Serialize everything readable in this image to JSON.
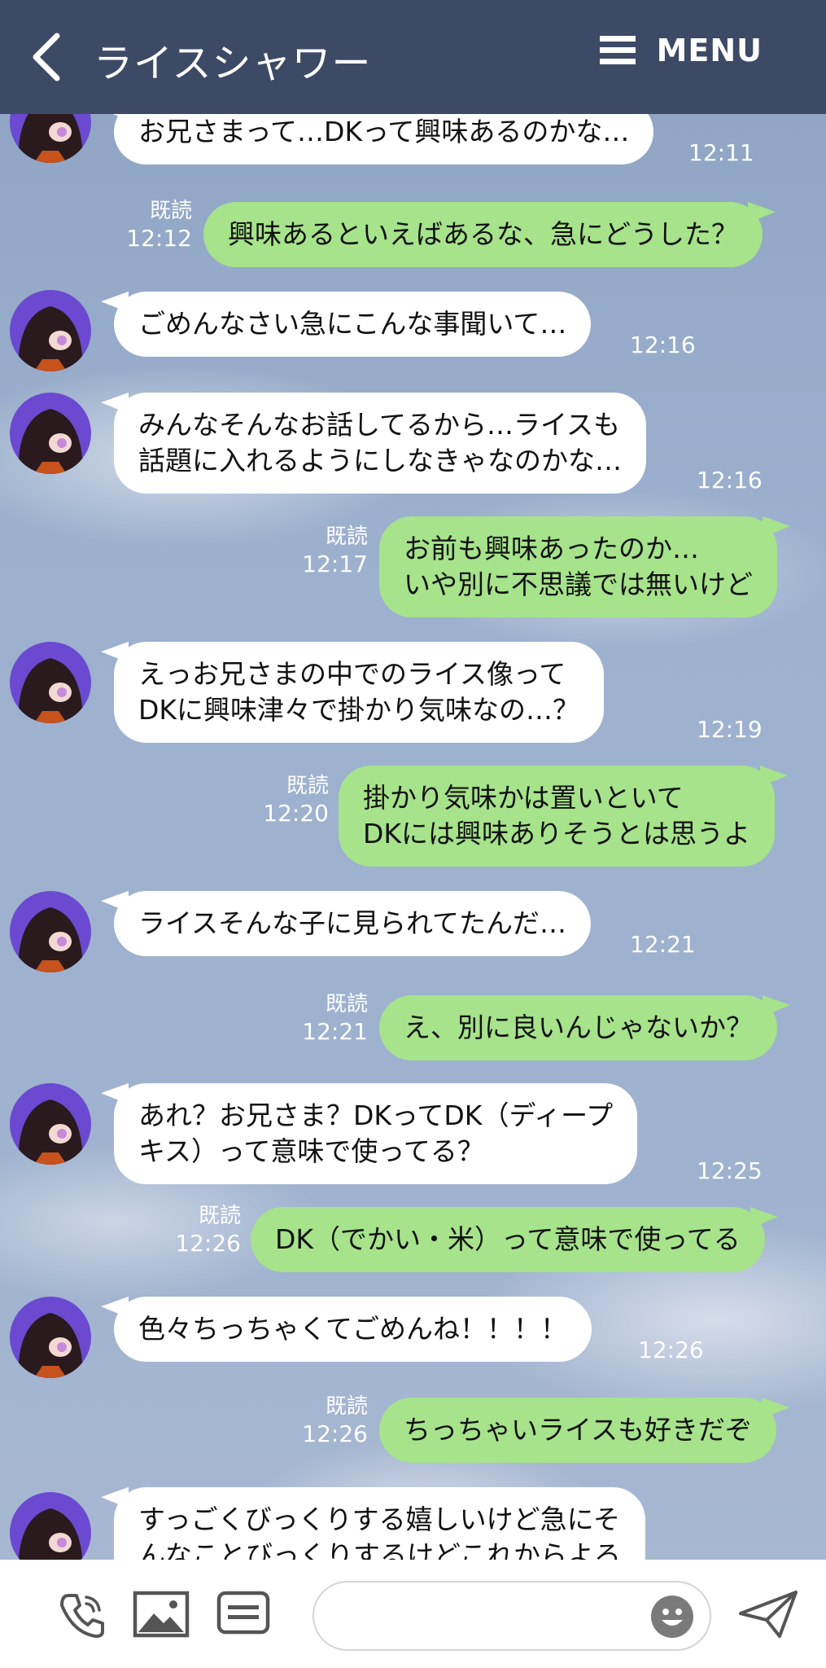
{
  "header": {
    "title": "ライスシャワー",
    "menu_label": "MENU"
  },
  "messages": [
    {
      "dir": "in",
      "lines": [
        "お兄さまって…DKって興味あるのかな…"
      ],
      "time": "12:11"
    },
    {
      "dir": "out",
      "lines": [
        "興味あるといえばあるな、急にどうした？"
      ],
      "read": "既読",
      "time": "12:12"
    },
    {
      "dir": "in",
      "lines": [
        "ごめんなさい急にこんな事聞いて…"
      ],
      "time": "12:16"
    },
    {
      "dir": "in",
      "lines": [
        "みんなそんなお話してるから…ライスも",
        "話題に入れるようにしなきゃなのかな…"
      ],
      "time": "12:16"
    },
    {
      "dir": "out",
      "lines": [
        "お前も興味あったのか…",
        "いや別に不思議では無いけど"
      ],
      "read": "既読",
      "time": "12:17"
    },
    {
      "dir": "in",
      "lines": [
        "えっお兄さまの中でのライス像って",
        "DKに興味津々で掛かり気味なの…？"
      ],
      "time": "12:19"
    },
    {
      "dir": "out",
      "lines": [
        "掛かり気味かは置いといて",
        "DKには興味ありそうとは思うよ"
      ],
      "read": "既読",
      "time": "12:20"
    },
    {
      "dir": "in",
      "lines": [
        "ライスそんな子に見られてたんだ…"
      ],
      "time": "12:21"
    },
    {
      "dir": "out",
      "lines": [
        "え、別に良いんじゃないか？"
      ],
      "read": "既読",
      "time": "12:21"
    },
    {
      "dir": "in",
      "lines": [
        "あれ？お兄さま？DKってDK（ディープ",
        "キス）って意味で使ってる？"
      ],
      "time": "12:25"
    },
    {
      "dir": "out",
      "lines": [
        "DK（でかい・米）って意味で使ってる"
      ],
      "read": "既読",
      "time": "12:26"
    },
    {
      "dir": "in",
      "lines": [
        "色々ちっちゃくてごめんね！！！！"
      ],
      "time": "12:26"
    },
    {
      "dir": "out",
      "lines": [
        "ちっちゃいライスも好きだぞ"
      ],
      "read": "既読",
      "time": "12:26"
    },
    {
      "dir": "in",
      "lines": [
        "すっごくびっくりする嬉しいけど急にそ",
        "んなことびっくりするけどこれからよろ"
      ],
      "time": ""
    }
  ],
  "toolbar": {
    "icons": [
      "phone-icon",
      "image-icon",
      "sticker-list-icon",
      "emoji-icon",
      "send-icon"
    ]
  },
  "colors": {
    "header": "#3c4a66",
    "bubble_out": "#a6e38b",
    "bubble_in": "#ffffff"
  }
}
